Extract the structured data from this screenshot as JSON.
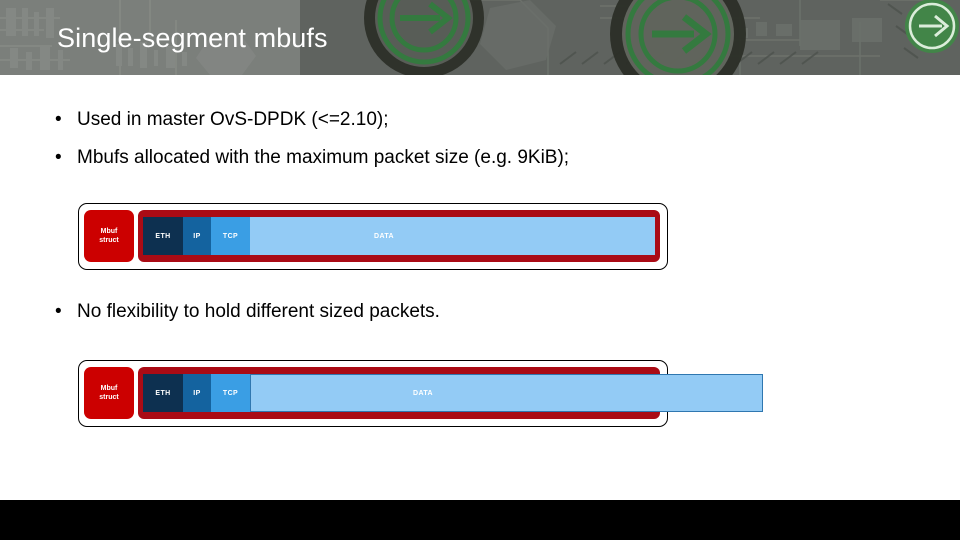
{
  "slide": {
    "title": "Single-segment mbufs",
    "background_color": "#ffffff",
    "header_color": "#4a4f4a",
    "accent_green": "#1e6b2a",
    "footer_color": "#000000"
  },
  "bullets": [
    {
      "marker": "•",
      "text": "Used in master OvS-DPDK (<=2.10);"
    },
    {
      "marker": "•",
      "text": "Mbufs allocated with the maximum packet size (e.g. 9KiB);"
    },
    {
      "marker": "•",
      "text": "No flexibility to hold different sized packets."
    }
  ],
  "diagrams": [
    {
      "name": "fitting-packet",
      "mbuf_struct_label_line1": "Mbuf",
      "mbuf_struct_label_line2": "struct",
      "mbuf_struct_color": "#cc0000",
      "container_color": "#aa0b15",
      "segments": [
        {
          "label": "ETH",
          "color": "#0d3050"
        },
        {
          "label": "IP",
          "color": "#14639f"
        },
        {
          "label": "TCP",
          "color": "#3a9ee4"
        },
        {
          "label": "DATA",
          "color": "#93cbf5"
        }
      ],
      "overflow": false
    },
    {
      "name": "overflowing-packet",
      "mbuf_struct_label_line1": "Mbuf",
      "mbuf_struct_label_line2": "struct",
      "mbuf_struct_color": "#cc0000",
      "container_color": "#aa0b15",
      "segments": [
        {
          "label": "ETH",
          "color": "#0d3050"
        },
        {
          "label": "IP",
          "color": "#14639f"
        },
        {
          "label": "TCP",
          "color": "#3a9ee4"
        },
        {
          "label": "DATA",
          "color": "#93cbf5"
        }
      ],
      "overflow": true
    }
  ]
}
